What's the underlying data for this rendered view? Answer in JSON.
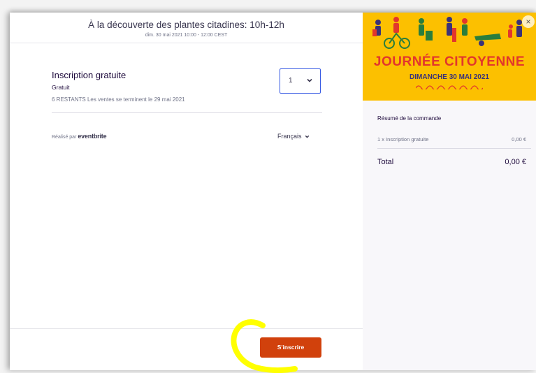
{
  "header": {
    "title": "À la découverte des plantes citadines: 10h-12h",
    "subtitle": "dim. 30 mai 2021 10:00 - 12:00 CEST"
  },
  "ticket": {
    "name": "Inscription gratuite",
    "price": "Gratuit",
    "status": "6 RESTANTS  Les ventes se terminent le 29 mai 2021",
    "quantity": "1"
  },
  "footer_links": {
    "powered_prefix": "Réalisé par",
    "powered_brand": "eventbrite",
    "language": "Français"
  },
  "actions": {
    "register_label": "S'inscrire"
  },
  "banner": {
    "title": "JOURNÉE CITOYENNE",
    "date": "DIMANCHE 30 MAI 2021",
    "close": "×"
  },
  "summary": {
    "heading": "Résumé de la commande",
    "line_item": "1 x Inscription gratuite",
    "line_price": "0,00 €",
    "total_label": "Total",
    "total_value": "0,00 €"
  },
  "colors": {
    "accent": "#d1410c",
    "select_border": "#3659e3",
    "banner_bg": "#fcc000",
    "banner_title": "#e2362c",
    "highlight": "#ffff00"
  }
}
